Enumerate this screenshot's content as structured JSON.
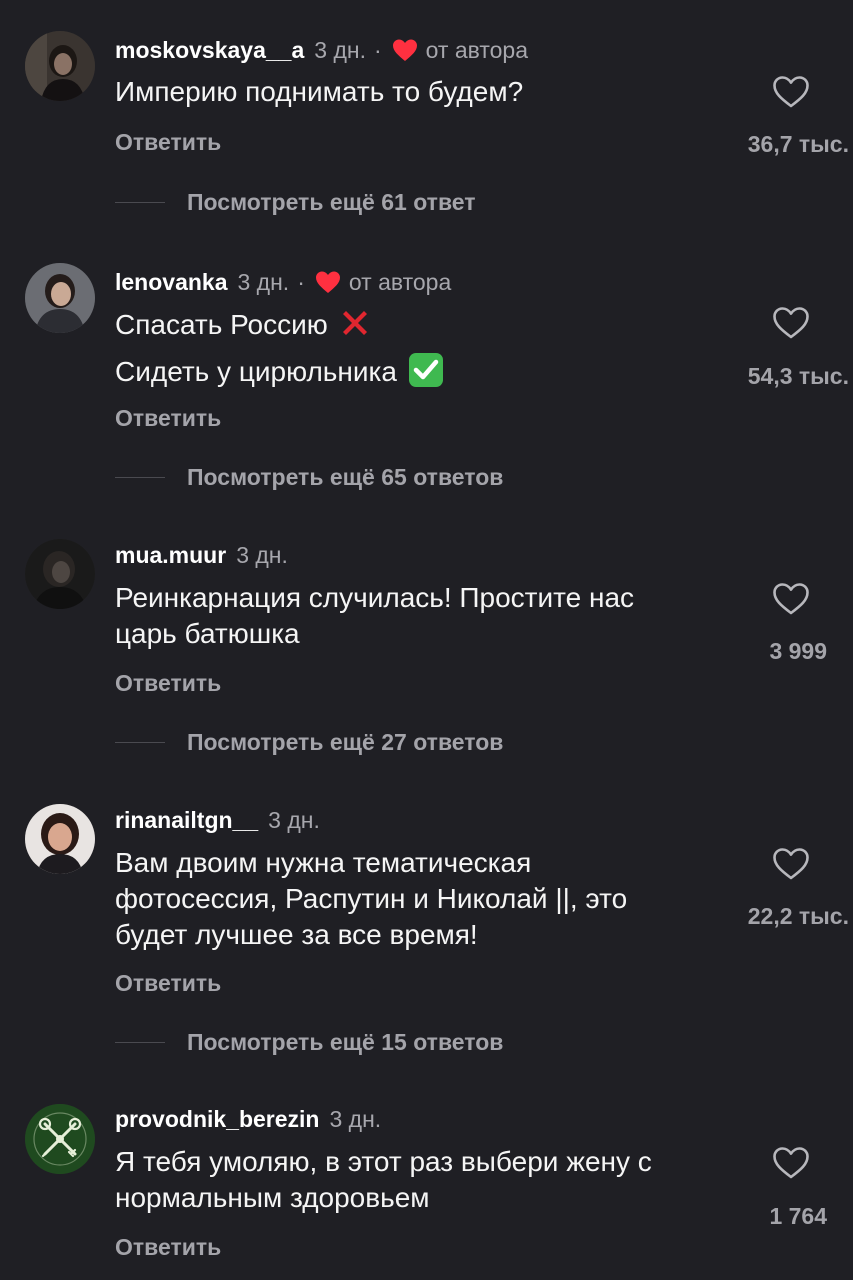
{
  "author_badge": "от автора",
  "reply_label": "Ответить",
  "accent": {
    "heart_red": "#ff3040",
    "check_green": "#3fb950",
    "cross_red": "#e0262f"
  },
  "comments": [
    {
      "username": "moskovskaya__a",
      "time": "3 дн.",
      "liked_by_author": true,
      "lines": [
        "Империю поднимать то будем?"
      ],
      "likes": "36,7 тыс.",
      "more_replies": "Посмотреть ещё 61 ответ"
    },
    {
      "username": "lenovanka",
      "time": "3 дн.",
      "liked_by_author": true,
      "lines": [
        "Спасать Россию",
        "Сидеть у цирюльника"
      ],
      "line_emojis": [
        "cross-mark-emoji",
        "check-mark-emoji"
      ],
      "likes": "54,3 тыс.",
      "more_replies": "Посмотреть ещё 65 ответов"
    },
    {
      "username": "mua.muur",
      "time": "3 дн.",
      "liked_by_author": false,
      "lines": [
        "Реинкарнация случилась! Простите нас",
        "царь батюшка"
      ],
      "likes": "3 999",
      "more_replies": "Посмотреть ещё 27 ответов"
    },
    {
      "username": "rinanailtgn__",
      "time": "3 дн.",
      "liked_by_author": false,
      "lines": [
        "Вам двоим нужна тематическая",
        "фотосессия, Распутин и Николай ||, это",
        "будет лучшее за все время!"
      ],
      "likes": "22,2 тыс.",
      "more_replies": "Посмотреть ещё 15 ответов"
    },
    {
      "username": "provodnik_berezin",
      "time": "3 дн.",
      "liked_by_author": false,
      "lines": [
        "Я тебя умоляю, в этот раз выбери жену с",
        "нормальным здоровьем"
      ],
      "likes": "1 764"
    }
  ]
}
